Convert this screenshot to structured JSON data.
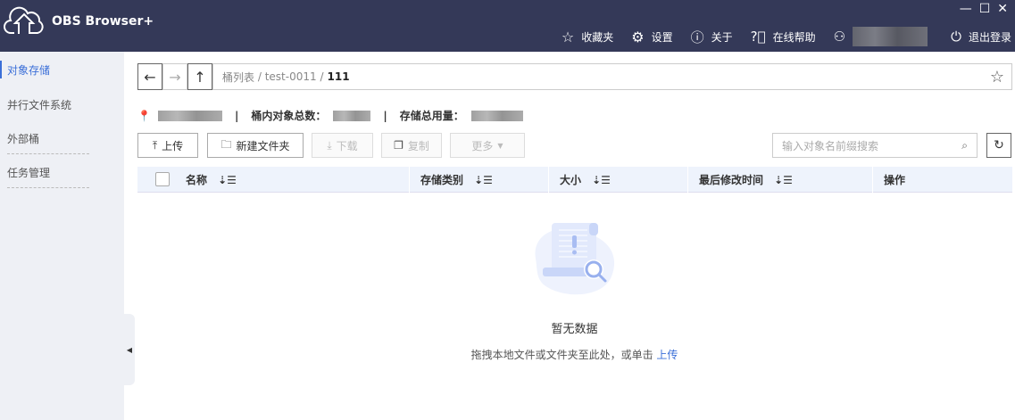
{
  "app": {
    "title": "OBS Browser+"
  },
  "header": {
    "favorites": "收藏夹",
    "settings": "设置",
    "about": "关于",
    "help": "在线帮助",
    "logout": "退出登录"
  },
  "sidebar": {
    "items": [
      {
        "label": "对象存储"
      },
      {
        "label": "并行文件系统"
      },
      {
        "label": "外部桶"
      },
      {
        "label": "任务管理"
      }
    ]
  },
  "address": {
    "root": "桶列表",
    "bucket": "test-0011",
    "current": "111",
    "sep": "/"
  },
  "info": {
    "objects_label": "桶内对象总数：",
    "usage_label": "存储总用量：",
    "sep": "|"
  },
  "toolbar": {
    "upload": "上传",
    "new_folder": "新建文件夹",
    "download": "下载",
    "copy": "复制",
    "more": "更多",
    "search_placeholder": "输入对象名前缀搜索"
  },
  "table": {
    "columns": [
      "名称",
      "存储类别",
      "大小",
      "最后修改时间",
      "操作"
    ]
  },
  "empty": {
    "title": "暂无数据",
    "hint": "拖拽本地文件或文件夹至此处，或单击",
    "link": "上传"
  },
  "colors": {
    "header": "#343958",
    "accent": "#3b6fd8",
    "sidebar": "#eef0f5"
  }
}
